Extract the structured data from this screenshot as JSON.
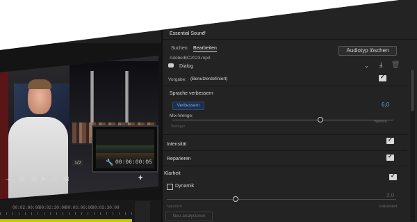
{
  "panel": {
    "title": "Essential Sound",
    "menu_icon": "≡",
    "tabs": [
      {
        "label": "Suchen"
      },
      {
        "label": "Bearbeiten"
      }
    ],
    "filename": "AdobeIBC2023.mp4",
    "clear_audiotype_label": "Audiotyp löschen",
    "audiotype": {
      "label": "Dialog",
      "icon": "speech-bubble-icon"
    },
    "preset": {
      "label": "Vorgabe:",
      "value": "(Benutzerdefiniert)"
    },
    "sections": {
      "speech": {
        "heading": "Sprache verbessern",
        "enhance_button": "Verbessern",
        "value": "6,0",
        "mix_label": "Mix-Menge:",
        "slider_min": "Weniger",
        "slider_max": "Weitere",
        "slider_level": 0.67
      },
      "intensity": {
        "heading": "Intensität"
      },
      "repair": {
        "heading": "Reparieren"
      },
      "clarity": {
        "heading": "Klarheit",
        "dynamics_label": "Dynamik",
        "value": "3,0",
        "slider_min": "Natürlich",
        "slider_max": "Fokussiert",
        "slider_level": 0.3
      }
    },
    "reanalyze_label": "Neu analysieren"
  },
  "monitor": {
    "fraction": "1/2",
    "timecode": "00:06:00:05"
  },
  "timeline": {
    "ruler_labels": [
      "00:02:00:00",
      "00:02:30:00",
      "00:03:00:00",
      "00:03:30:00"
    ]
  },
  "colors": {
    "accent_blue": "#6aa6f0",
    "panel_bg": "#232323",
    "track_yellow": "#c8c800"
  }
}
